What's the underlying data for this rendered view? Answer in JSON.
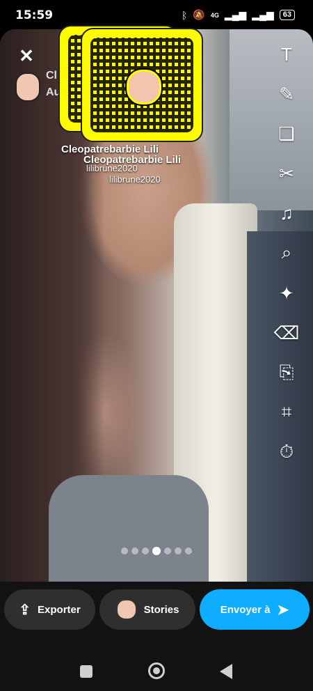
{
  "status_bar": {
    "time": "15:59",
    "battery": "63",
    "signal_label": "4G"
  },
  "header": {
    "close_symbol": "✕",
    "cut_name": "Cl",
    "cut_sub": "Au"
  },
  "stickers": [
    {
      "name": "Cleopatrebarbie Lili",
      "username": "lilibrune2020"
    },
    {
      "name": "Cleopatrebarbie Lili",
      "username": "lilibrune2020"
    }
  ],
  "tools": [
    {
      "icon": "text-icon",
      "glyph": "T"
    },
    {
      "icon": "pencil-icon",
      "glyph": "✎"
    },
    {
      "icon": "sticker-icon",
      "glyph": "❏"
    },
    {
      "icon": "scissors-icon",
      "glyph": "✂"
    },
    {
      "icon": "music-icon",
      "glyph": "♫"
    },
    {
      "icon": "lens-search-icon",
      "glyph": "⌕"
    },
    {
      "icon": "magic-wand-icon",
      "glyph": "✦"
    },
    {
      "icon": "magic-eraser-icon",
      "glyph": "⌫"
    },
    {
      "icon": "paperclip-icon",
      "glyph": "⎘"
    },
    {
      "icon": "crop-icon",
      "glyph": "⌗"
    },
    {
      "icon": "timer-icon",
      "glyph": "⏱"
    }
  ],
  "pager": {
    "count": 7,
    "active_index": 3
  },
  "actions": {
    "export_label": "Exporter",
    "stories_label": "Stories",
    "send_label": "Envoyer à"
  },
  "colors": {
    "send_button": "#0fadff",
    "snapcode": "#fffc00"
  }
}
